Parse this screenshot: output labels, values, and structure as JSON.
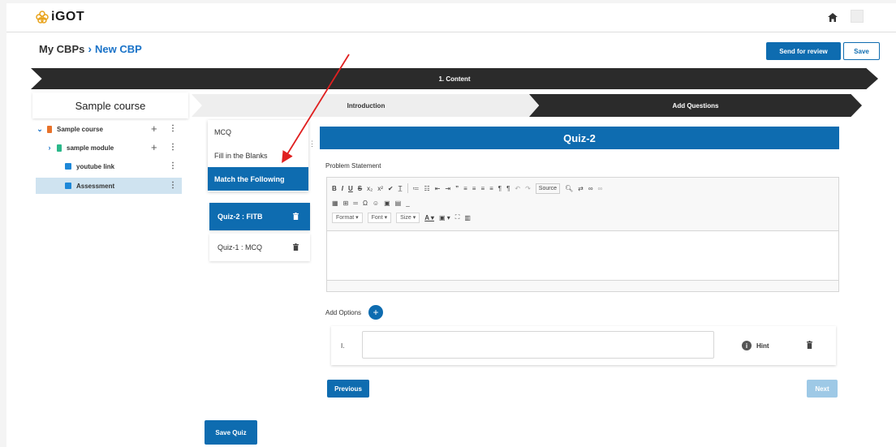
{
  "app": {
    "logo": "iGOT"
  },
  "breadcrumb": {
    "root": "My CBPs",
    "separator": "›",
    "current": "New CBP"
  },
  "actions": {
    "send_review": "Send for review",
    "save": "Save"
  },
  "steps": {
    "content": "1. Content",
    "intro": "Introduction",
    "add_questions": "Add Questions"
  },
  "sidebar": {
    "title": "Sample course",
    "items": [
      {
        "label": "Sample course"
      },
      {
        "label": "sample module"
      },
      {
        "label": "youtube link"
      },
      {
        "label": "Assessment"
      }
    ]
  },
  "question_types": [
    "MCQ",
    "Fill in the Blanks",
    "Match the Following"
  ],
  "quizzes": [
    {
      "label": "Quiz-2 : FITB"
    },
    {
      "label": "Quiz-1 : MCQ"
    }
  ],
  "quiz": {
    "title": "Quiz-2",
    "problem_label": "Problem Statement",
    "toolbar": {
      "format": "Format",
      "font": "Font",
      "size": "Size",
      "source": "Source"
    },
    "add_options": "Add Options",
    "option_number": "I.",
    "hint": "Hint",
    "previous": "Previous",
    "next": "Next"
  },
  "save_quiz": "Save Quiz",
  "colors": {
    "primary": "#0e6cb0",
    "dark_step": "#2b2b2b",
    "annotation_arrow": "#e02020"
  }
}
